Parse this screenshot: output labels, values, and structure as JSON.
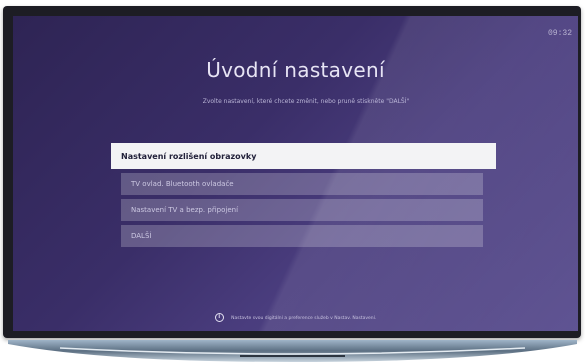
{
  "screen": {
    "clock": "09:32",
    "title": "Úvodní nastavení",
    "subtitle": "Zvolte nastavení, které chcete změnit, nebo pruně stiskněte \"DALŠÍ\"",
    "menu": [
      {
        "label": "Nastavení rozlišení obrazovky",
        "selected": true
      },
      {
        "label": "TV ovlad. Bluetooth ovladače",
        "selected": false
      },
      {
        "label": "Nastavení TV a bezp. připojení",
        "selected": false
      },
      {
        "label": "DALŠÍ",
        "selected": false
      }
    ],
    "footer_note": "Nastavte svou digitální a preference služeb v Nastav. Nastavení."
  },
  "colors": {
    "background_start": "#2e2454",
    "background_end": "#5a4e8f",
    "selected_bg": "#f3f3f5",
    "selected_text": "#22213a",
    "item_text": "#ccc8e2"
  },
  "icons": {
    "footer": "info-icon"
  }
}
